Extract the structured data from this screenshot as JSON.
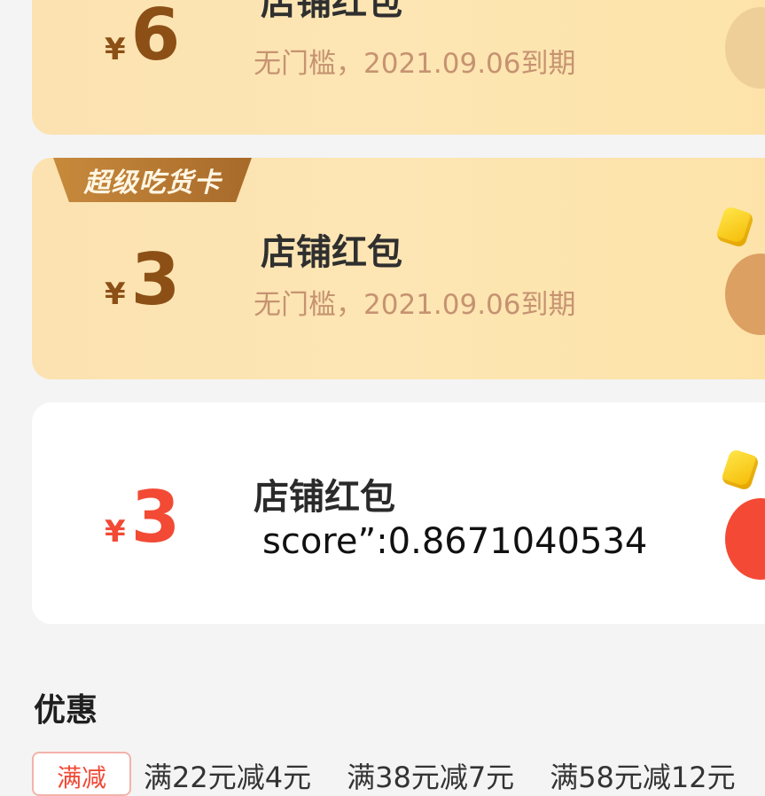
{
  "coupons": [
    {
      "currency": "¥",
      "amount": "6",
      "title": "店铺红包",
      "desc": "无门槛，2021.09.06到期"
    },
    {
      "badge": "超级吃货卡",
      "currency": "¥",
      "amount": "3",
      "title": "店铺红包",
      "desc": "无门槛，2021.09.06到期"
    },
    {
      "currency": "¥",
      "amount": "3",
      "title": "店铺红包",
      "score": "score”:0.8671040534"
    }
  ],
  "discounts": {
    "title": "优惠",
    "tag": "满减",
    "items": [
      "满22元减4元",
      "满38元减7元",
      "满58元减12元"
    ]
  },
  "colors": {
    "gold_amount": "#8c4f16",
    "red_amount": "#f24a35",
    "desc": "#c69372"
  }
}
